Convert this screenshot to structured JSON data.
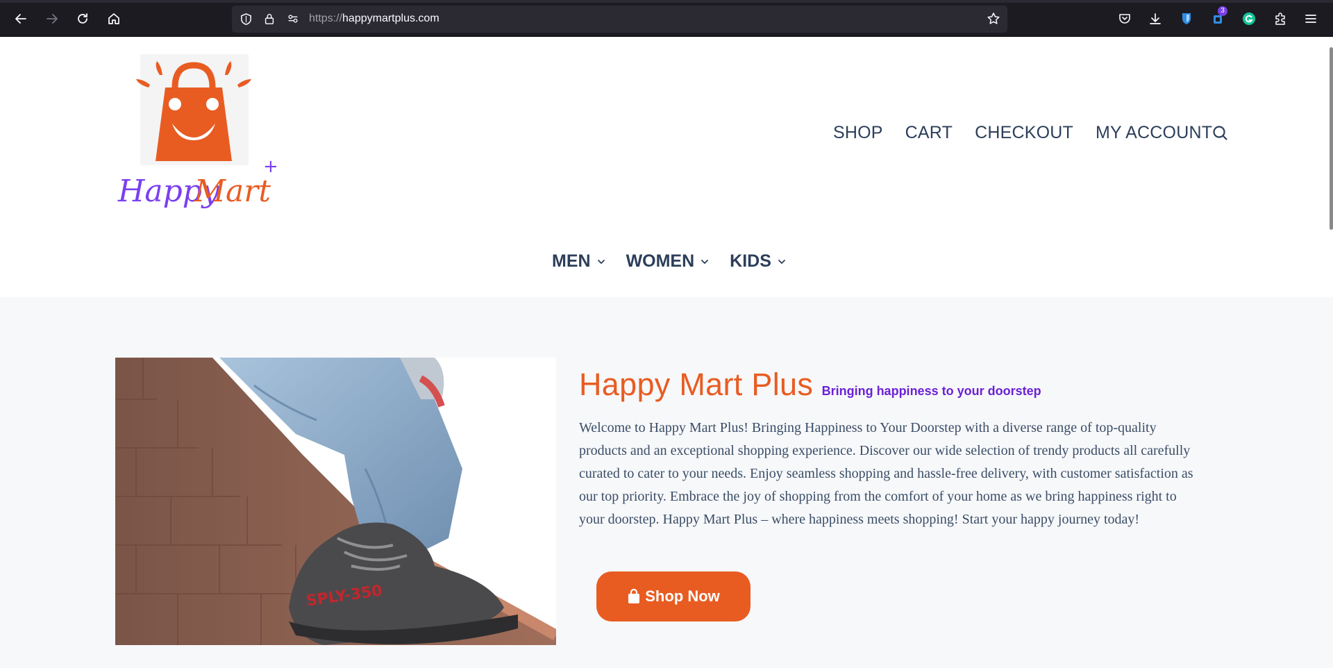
{
  "browser": {
    "url_scheme": "https://",
    "url_host": "happymartplus.com",
    "extension_badge": "3"
  },
  "header": {
    "logo_text_happy": "Happy",
    "logo_text_mart": "Mart",
    "logo_plus": "+",
    "nav": [
      "SHOP",
      "CART",
      "CHECKOUT",
      "MY ACCOUNT"
    ]
  },
  "categories": [
    "MEN",
    "WOMEN",
    "KIDS"
  ],
  "hero": {
    "title": "Happy Mart Plus",
    "tagline": "Bringing happiness to your doorstep",
    "body": "Welcome to Happy Mart Plus! Bringing Happiness to Your Doorstep with a diverse range of top-quality products and an exceptional shopping experience. Discover our wide selection of trendy products all carefully curated to cater to your needs. Enjoy seamless shopping and hassle-free delivery, with customer satisfaction as our top priority. Embrace the joy of shopping from the comfort of your home as we bring happiness right to your doorstep. Happy Mart Plus – where happiness meets shopping! Start your happy journey today!",
    "cta_label": "Shop Now",
    "shoe_text": "SPLY-350"
  },
  "colors": {
    "brand_orange": "#e85c22",
    "brand_purple": "#6b21d6",
    "nav_text": "#2c3e5a"
  }
}
